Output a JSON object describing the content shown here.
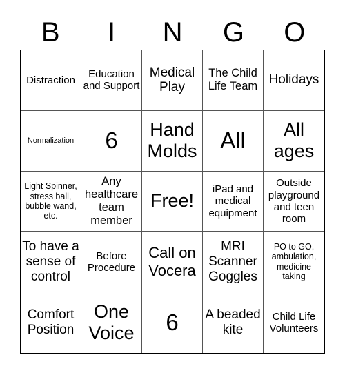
{
  "header": [
    "B",
    "I",
    "N",
    "G",
    "O"
  ],
  "cells": [
    "Distraction",
    "Education and Support",
    "Medical Play",
    "The Child Life Team",
    "Holidays",
    "Normalization",
    "6",
    "Hand Molds",
    "All",
    "All ages",
    "Light Spinner, stress ball, bubble wand, etc.",
    "Any healthcare team member",
    "Free!",
    "iPad and medical equipment",
    "Outside playground and teen room",
    "To have a sense of control",
    "Before Procedure",
    "Call on Vocera",
    "MRI Scanner Goggles",
    "PO to GO, ambulation, medicine taking",
    "Comfort Position",
    "One Voice",
    "6",
    "A beaded kite",
    "Child Life Volunteers"
  ]
}
